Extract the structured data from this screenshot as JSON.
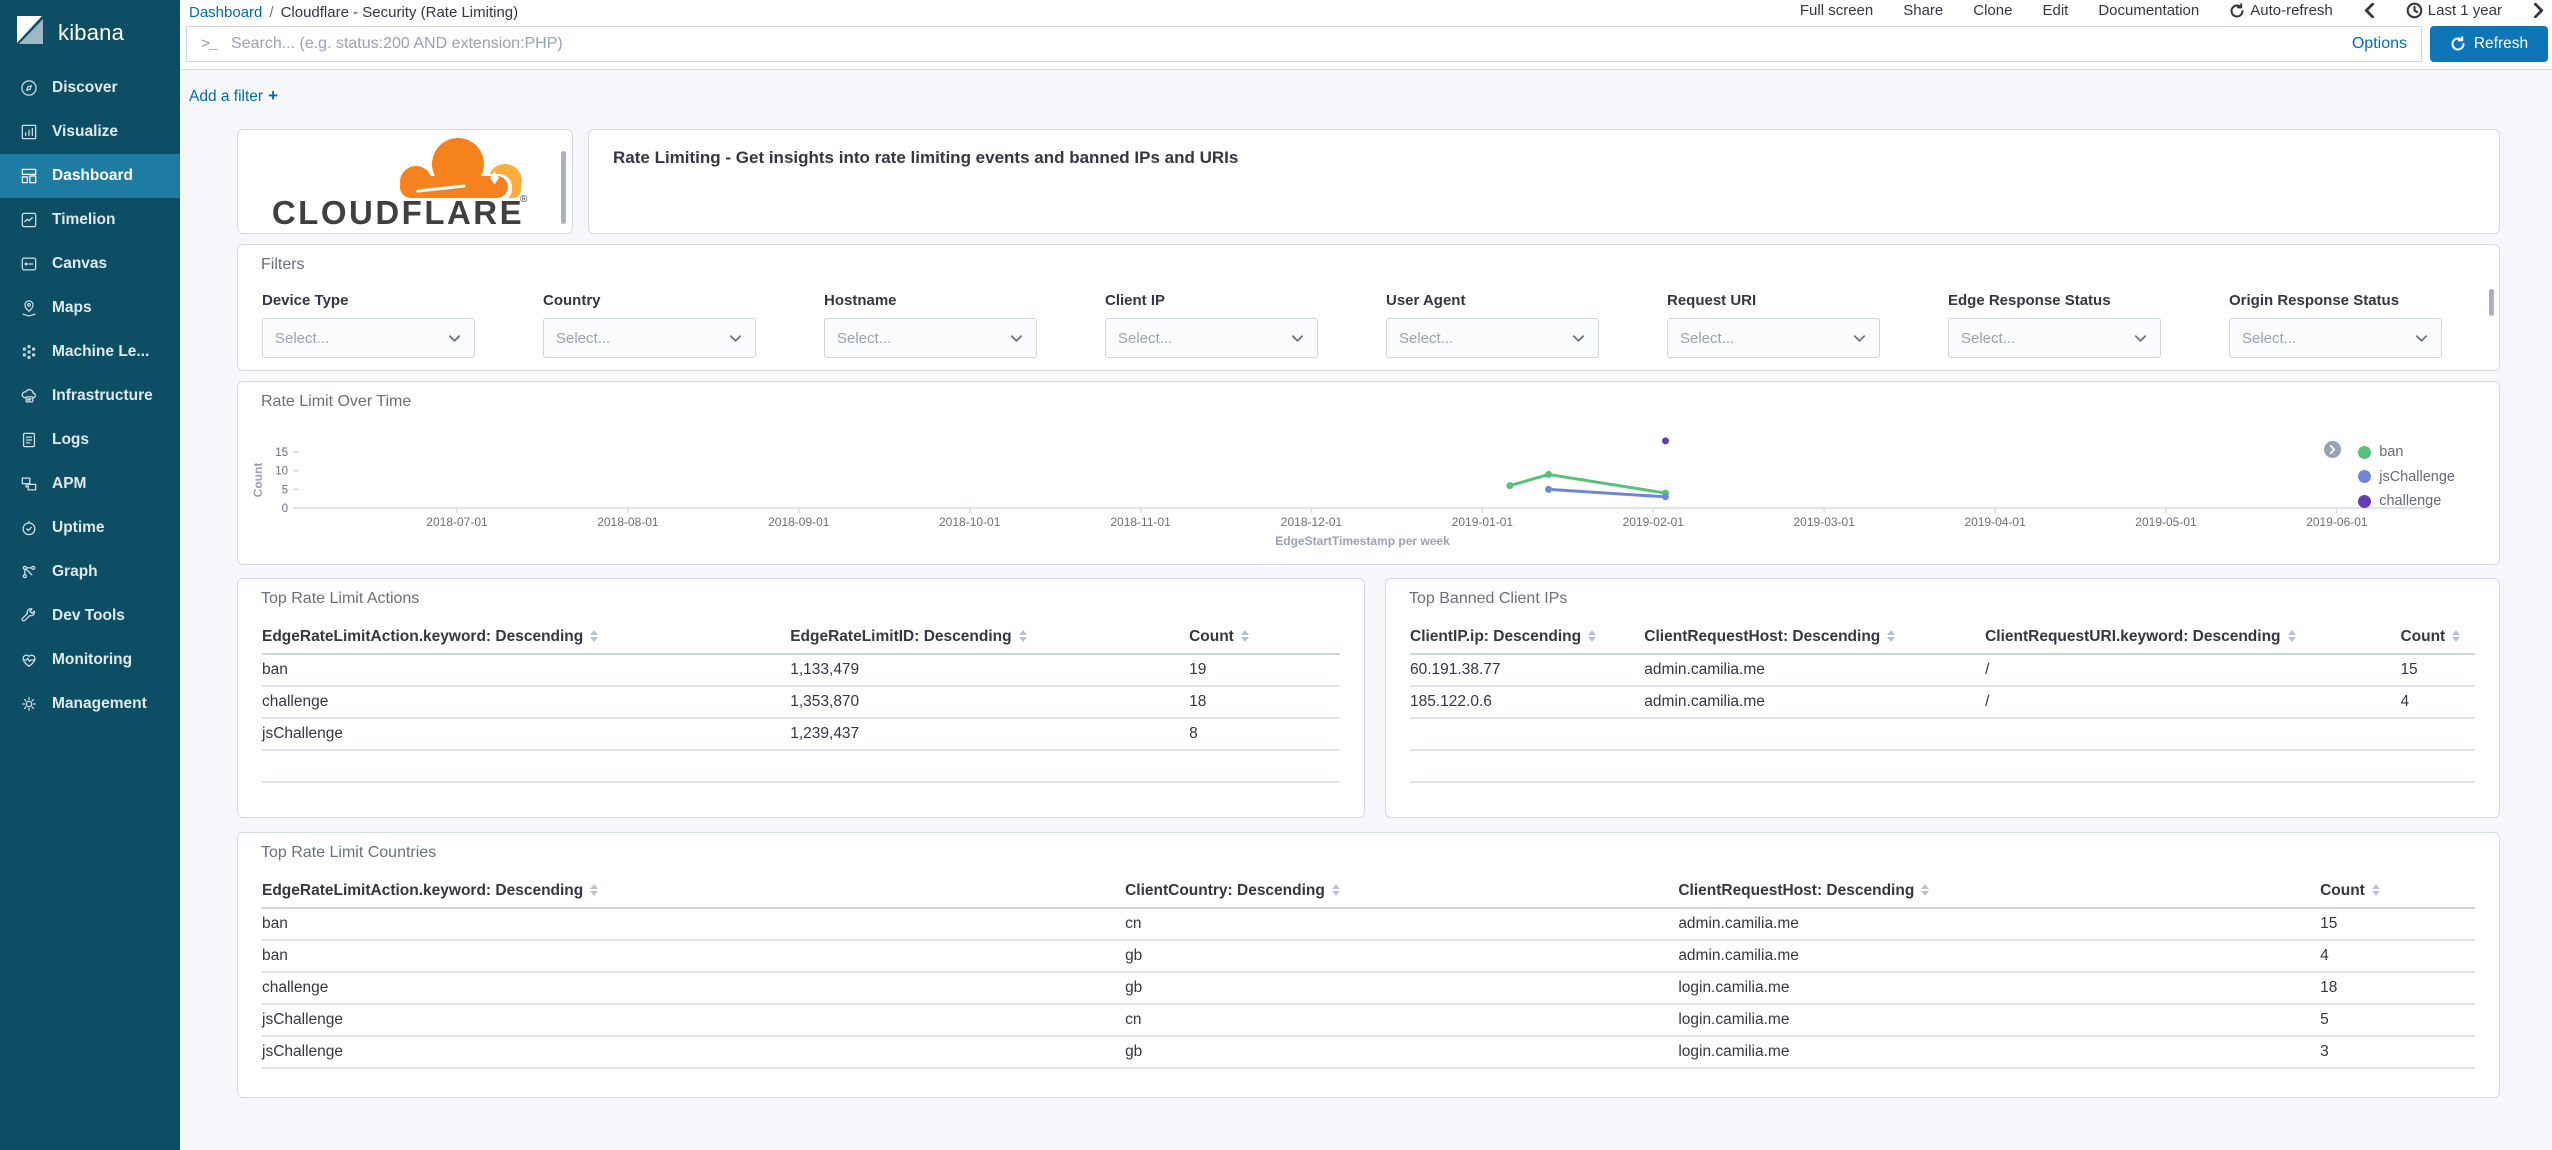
{
  "sidebar": {
    "brand": "kibana",
    "items": [
      {
        "label": "Discover",
        "icon": "discover-icon"
      },
      {
        "label": "Visualize",
        "icon": "visualize-icon"
      },
      {
        "label": "Dashboard",
        "icon": "dashboard-icon",
        "active": true
      },
      {
        "label": "Timelion",
        "icon": "timelion-icon"
      },
      {
        "label": "Canvas",
        "icon": "canvas-icon"
      },
      {
        "label": "Maps",
        "icon": "maps-icon"
      },
      {
        "label": "Machine Le...",
        "icon": "machine-learning-icon"
      },
      {
        "label": "Infrastructure",
        "icon": "infrastructure-icon"
      },
      {
        "label": "Logs",
        "icon": "logs-icon"
      },
      {
        "label": "APM",
        "icon": "apm-icon"
      },
      {
        "label": "Uptime",
        "icon": "uptime-icon"
      },
      {
        "label": "Graph",
        "icon": "graph-icon"
      },
      {
        "label": "Dev Tools",
        "icon": "dev-tools-icon"
      },
      {
        "label": "Monitoring",
        "icon": "monitoring-icon"
      },
      {
        "label": "Management",
        "icon": "management-icon"
      }
    ]
  },
  "breadcrumb": {
    "root": "Dashboard",
    "separator": "/",
    "current": "Cloudflare - Security (Rate Limiting)"
  },
  "topnav": {
    "full_screen": "Full screen",
    "share": "Share",
    "clone": "Clone",
    "edit": "Edit",
    "documentation": "Documentation",
    "auto_refresh": "Auto-refresh",
    "time_range": "Last 1 year"
  },
  "querybar": {
    "placeholder": "Search... (e.g. status:200 AND extension:PHP)",
    "options": "Options",
    "refresh": "Refresh"
  },
  "filter_bar": {
    "add_label": "Add a filter",
    "plus": "+"
  },
  "markdown": {
    "logo_text": "CLOUDFLARE",
    "logo_orange": "#F6821F",
    "logo_light_orange": "#FBAD41",
    "title": "Rate Limiting - Get insights into rate limiting events and banned IPs and URIs"
  },
  "filters": {
    "panel_title": "Filters",
    "placeholder": "Select...",
    "fields": [
      "Device Type",
      "Country",
      "Hostname",
      "Client IP",
      "User Agent",
      "Request URI",
      "Edge Response Status",
      "Origin Response Status"
    ]
  },
  "chart_data": {
    "type": "line",
    "title": "Rate Limit Over Time",
    "xlabel": "EdgeStartTimestamp per week",
    "ylabel": "Count",
    "ylim": [
      0,
      18
    ],
    "y_ticks": [
      0,
      5,
      10,
      15
    ],
    "x_ticks": [
      "2018-07-01",
      "2018-08-01",
      "2018-09-01",
      "2018-10-01",
      "2018-11-01",
      "2018-12-01",
      "2019-01-01",
      "2019-02-01",
      "2019-03-01",
      "2019-04-01",
      "2019-05-01",
      "2019-06-01"
    ],
    "legend_position": "right",
    "grid": false,
    "series": [
      {
        "name": "ban",
        "color": "#57c17b",
        "points": [
          [
            "2019-01-06",
            6
          ],
          [
            "2019-01-13",
            9
          ],
          [
            "2019-02-03",
            4
          ]
        ]
      },
      {
        "name": "jsChallenge",
        "color": "#6f87d8",
        "points": [
          [
            "2019-01-13",
            5
          ],
          [
            "2019-02-03",
            3
          ]
        ]
      },
      {
        "name": "challenge",
        "color": "#663db8",
        "points": [
          [
            "2019-02-03",
            18
          ]
        ]
      }
    ]
  },
  "tables": {
    "actions": {
      "title": "Top Rate Limit Actions",
      "columns": [
        "EdgeRateLimitAction.keyword: Descending",
        "EdgeRateLimitID: Descending",
        "Count"
      ],
      "rows": [
        [
          "ban",
          "1,133,479",
          "19"
        ],
        [
          "challenge",
          "1,353,870",
          "18"
        ],
        [
          "jsChallenge",
          "1,239,437",
          "8"
        ]
      ],
      "empty_rows": 1
    },
    "banned_ips": {
      "title": "Top Banned Client IPs",
      "columns": [
        "ClientIP.ip: Descending",
        "ClientRequestHost: Descending",
        "ClientRequestURI.keyword: Descending",
        "Count"
      ],
      "rows": [
        [
          "60.191.38.77",
          "admin.camilia.me",
          "/",
          "15"
        ],
        [
          "185.122.0.6",
          "admin.camilia.me",
          "/",
          "4"
        ]
      ],
      "empty_rows": 2
    },
    "countries": {
      "title": "Top Rate Limit Countries",
      "columns": [
        "EdgeRateLimitAction.keyword: Descending",
        "ClientCountry: Descending",
        "ClientRequestHost: Descending",
        "Count"
      ],
      "rows": [
        [
          "ban",
          "cn",
          "admin.camilia.me",
          "15"
        ],
        [
          "ban",
          "gb",
          "admin.camilia.me",
          "4"
        ],
        [
          "challenge",
          "gb",
          "login.camilia.me",
          "18"
        ],
        [
          "jsChallenge",
          "cn",
          "login.camilia.me",
          "5"
        ],
        [
          "jsChallenge",
          "gb",
          "login.camilia.me",
          "3"
        ]
      ],
      "empty_rows": 0
    }
  }
}
